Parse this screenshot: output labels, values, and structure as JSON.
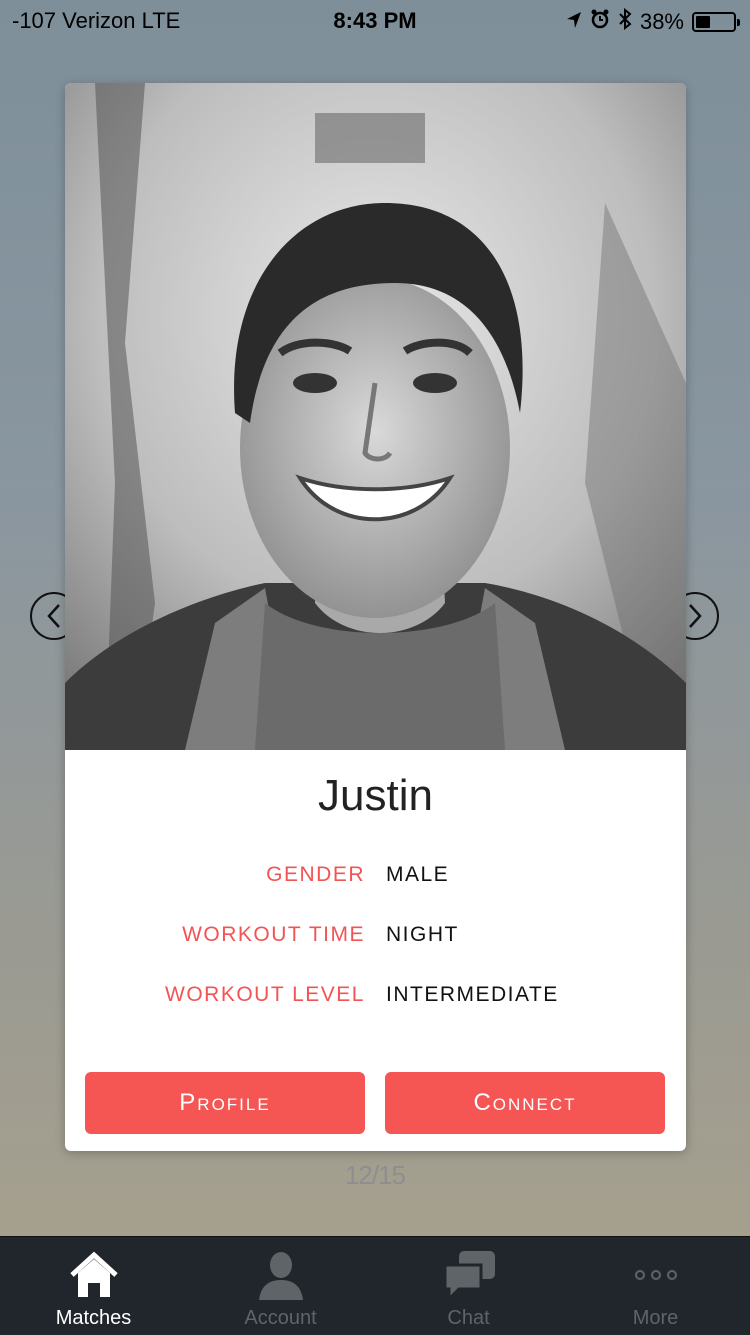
{
  "status_bar": {
    "carrier": "-107 Verizon  LTE",
    "time": "8:43 PM",
    "battery": "38%",
    "battery_level": 0.38,
    "icons": [
      "location-icon",
      "alarm-icon",
      "bluetooth-icon",
      "battery-icon"
    ]
  },
  "profile": {
    "name": "Justin",
    "fields": [
      {
        "label": "GENDER",
        "value": "MALE"
      },
      {
        "label": "WORKOUT TIME",
        "value": "NIGHT"
      },
      {
        "label": "WORKOUT LEVEL",
        "value": "INTERMEDIATE"
      }
    ],
    "photo": "black-and-white portrait photo"
  },
  "buttons": {
    "profile": "Profile",
    "connect": "Connect"
  },
  "pager": {
    "counter": "12/15"
  },
  "tabs": [
    {
      "label": "Matches",
      "icon": "home-icon",
      "active": true
    },
    {
      "label": "Account",
      "icon": "person-icon",
      "active": false
    },
    {
      "label": "Chat",
      "icon": "chat-icon",
      "active": false
    },
    {
      "label": "More",
      "icon": "more-dots-icon",
      "active": false
    }
  ],
  "colors": {
    "accent": "#f55553",
    "tabbar": "#20262b",
    "tab_inactive": "#5f6468"
  }
}
